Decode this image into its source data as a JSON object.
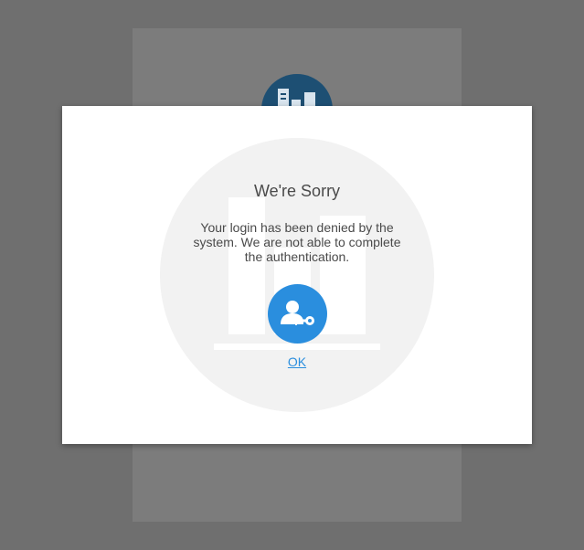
{
  "dialog": {
    "title": "We're Sorry",
    "message": "Your login has been denied by the system. We are not able to complete the authentication.",
    "ok_label": "OK"
  },
  "icons": {
    "background_logo": "building-logo-icon",
    "watermark": "building-watermark-icon",
    "auth": "user-key-icon"
  },
  "colors": {
    "overlay": "#6f6f6f",
    "modal_background": "#ffffff",
    "watermark": "#f2f2f2",
    "accent": "#2a8ede",
    "logo_background": "#1d4f73",
    "text": "#4a4a4a"
  }
}
